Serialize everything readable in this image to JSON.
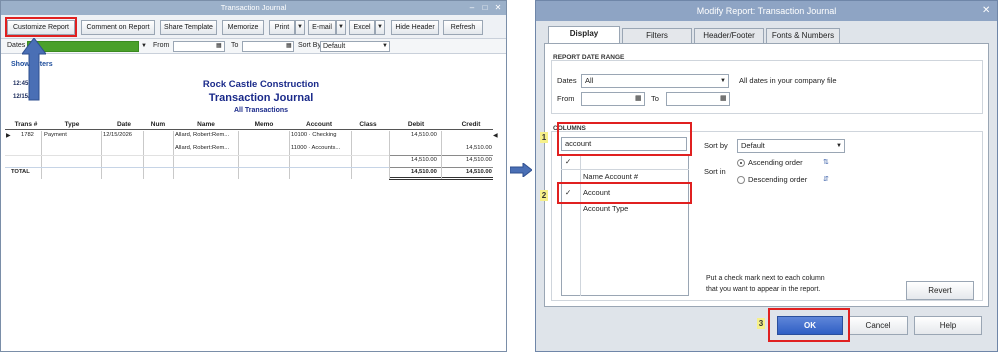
{
  "left_window": {
    "title": "Transaction Journal",
    "toolbar": {
      "customize": "Customize Report",
      "comment": "Comment on Report",
      "share": "Share Template",
      "memorize": "Memorize",
      "print": "Print",
      "email": "E-mail",
      "excel": "Excel",
      "hide_header": "Hide Header",
      "refresh": "Refresh"
    },
    "filters": {
      "dates_label": "Dates",
      "from_label": "From",
      "to_label": "To",
      "sort_by_label": "Sort By",
      "sort_by_value": "Default"
    },
    "show_filters": "Show Filters",
    "report": {
      "time": "12:45 PM",
      "date": "12/15/26",
      "company": "Rock Castle Construction",
      "title": "Transaction Journal",
      "subtitle": "All Transactions"
    },
    "columns": [
      "Trans #",
      "Type",
      "Date",
      "Num",
      "Name",
      "Memo",
      "Account",
      "Class",
      "Debit",
      "Credit"
    ],
    "rows": [
      {
        "trans": "1782",
        "type": "Payment",
        "date": "12/15/2026",
        "num": "",
        "name": "Allard, Robert:Rem...",
        "memo": "",
        "account": "10100 · Checking",
        "class": "",
        "debit": "14,510.00",
        "credit": ""
      },
      {
        "trans": "",
        "type": "",
        "date": "",
        "num": "",
        "name": "Allard, Robert:Rem...",
        "memo": "",
        "account": "11000 · Accounts...",
        "class": "",
        "debit": "",
        "credit": "14,510.00"
      }
    ],
    "subtotal": {
      "debit": "14,510.00",
      "credit": "14,510.00"
    },
    "total": {
      "label": "TOTAL",
      "debit": "14,510.00",
      "credit": "14,510.00"
    }
  },
  "right_window": {
    "title": "Modify Report: Transaction Journal",
    "tabs": [
      "Display",
      "Filters",
      "Header/Footer",
      "Fonts & Numbers"
    ],
    "active_tab": "Display",
    "date_range": {
      "section": "REPORT DATE RANGE",
      "dates_label": "Dates",
      "dates_value": "All",
      "dates_hint": "All dates in your company file",
      "from_label": "From",
      "to_label": "To"
    },
    "columns_section": {
      "section": "COLUMNS",
      "search_value": "account",
      "list_header_check": "✓",
      "items": [
        {
          "checked": false,
          "label": "Name Account #"
        },
        {
          "checked": true,
          "label": "Account"
        },
        {
          "checked": false,
          "label": "Account Type"
        }
      ],
      "sort_by_label": "Sort by",
      "sort_by_value": "Default",
      "sort_in_label": "Sort in",
      "ascending": "Ascending order",
      "descending": "Descending order",
      "hint_line1": "Put a check mark next to each column",
      "hint_line2": "that you want to appear in the report."
    },
    "buttons": {
      "revert": "Revert",
      "ok": "OK",
      "cancel": "Cancel",
      "help": "Help"
    }
  },
  "step_numbers": [
    "1",
    "2",
    "3"
  ],
  "colors": {
    "highlight": "#e02020",
    "arrow": "#4a6fb5",
    "dates_fill": "#4aa02a",
    "step_bg": "#f6f08a",
    "ok_button": "#2f5fc4"
  }
}
